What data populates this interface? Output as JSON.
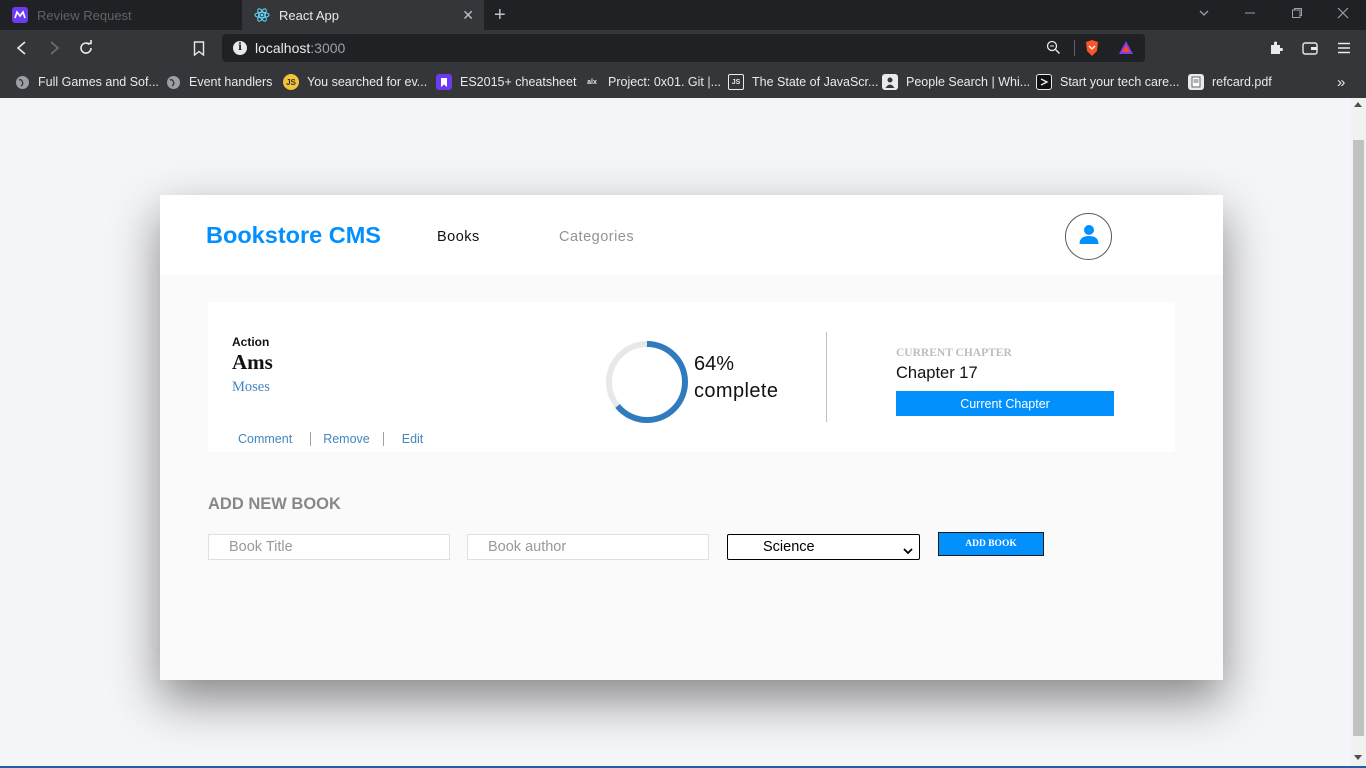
{
  "browser": {
    "tabs": [
      {
        "title": "Review Request",
        "active": false
      },
      {
        "title": "React App",
        "active": true
      }
    ],
    "address": {
      "host": "localhost",
      "port": ":3000"
    },
    "bookmarks": [
      {
        "label": "Full Games and Sof...",
        "icon": "globe-icon"
      },
      {
        "label": "Event handlers",
        "icon": "globe-icon"
      },
      {
        "label": "You searched for ev...",
        "icon": "js-icon"
      },
      {
        "label": "ES2015+ cheatsheet",
        "icon": "bookmark-purple-icon"
      },
      {
        "label": "Project: 0x01. Git |...",
        "icon": "alx-icon"
      },
      {
        "label": "The State of JavaScr...",
        "icon": "js-box-icon"
      },
      {
        "label": "People Search | Whi...",
        "icon": "person-icon"
      },
      {
        "label": "Start your tech care...",
        "icon": "microverse-icon"
      },
      {
        "label": "refcard.pdf",
        "icon": "pdf-icon"
      }
    ],
    "more_bookmarks": "»"
  },
  "app": {
    "brand": "Bookstore CMS",
    "nav": {
      "books": "Books",
      "categories": "Categories"
    },
    "book": {
      "genre": "Action",
      "title": "Ams",
      "author": "Moses",
      "actions": {
        "comment": "Comment",
        "remove": "Remove",
        "edit": "Edit"
      },
      "progress_percent": 64,
      "progress_label": "64%",
      "complete_label": "complete",
      "chapter_heading": "CURRENT CHAPTER",
      "chapter": "Chapter 17",
      "chapter_button": "Current Chapter"
    },
    "form": {
      "heading": "ADD NEW BOOK",
      "title_placeholder": "Book Title",
      "author_placeholder": "Book author",
      "category_selected": "Science",
      "submit": "ADD BOOK"
    }
  },
  "colors": {
    "accent": "#0290ff",
    "author_link": "#4386bf",
    "progress_track": "#e8e8e8",
    "progress_fill": "#307bbe"
  }
}
